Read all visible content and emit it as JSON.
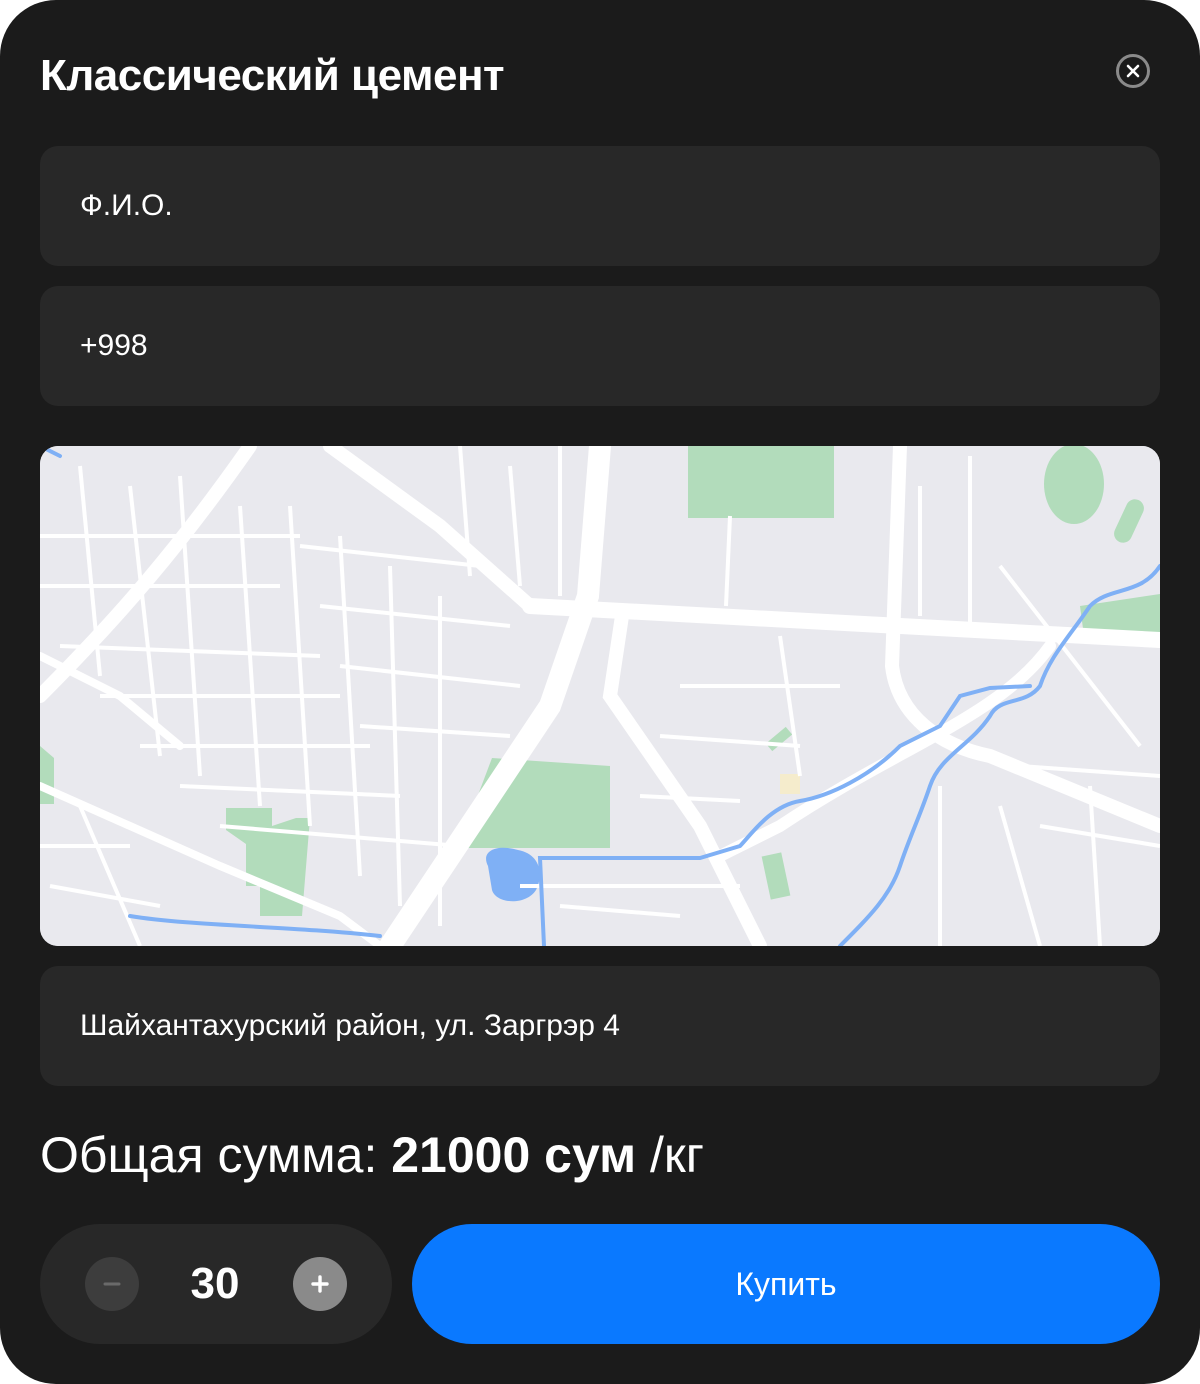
{
  "modal": {
    "title": "Классический цемент",
    "close_icon": "close-icon"
  },
  "form": {
    "name_placeholder": "Ф.И.О.",
    "phone_value": "+998",
    "address": "Шайхантахурский район, ул. Заргрэр 4"
  },
  "total": {
    "label": "Общая сумма:",
    "amount": "21000 сум",
    "unit": "/кг"
  },
  "quantity": {
    "value": "30",
    "minus_icon": "minus-icon",
    "plus_icon": "plus-icon"
  },
  "actions": {
    "buy_label": "Купить"
  },
  "colors": {
    "background": "#1b1b1b",
    "field": "#282828",
    "accent": "#0a79ff",
    "map_park": "#b2dcbb",
    "map_water": "#7fb0f5",
    "map_land": "#e9e9ee"
  }
}
